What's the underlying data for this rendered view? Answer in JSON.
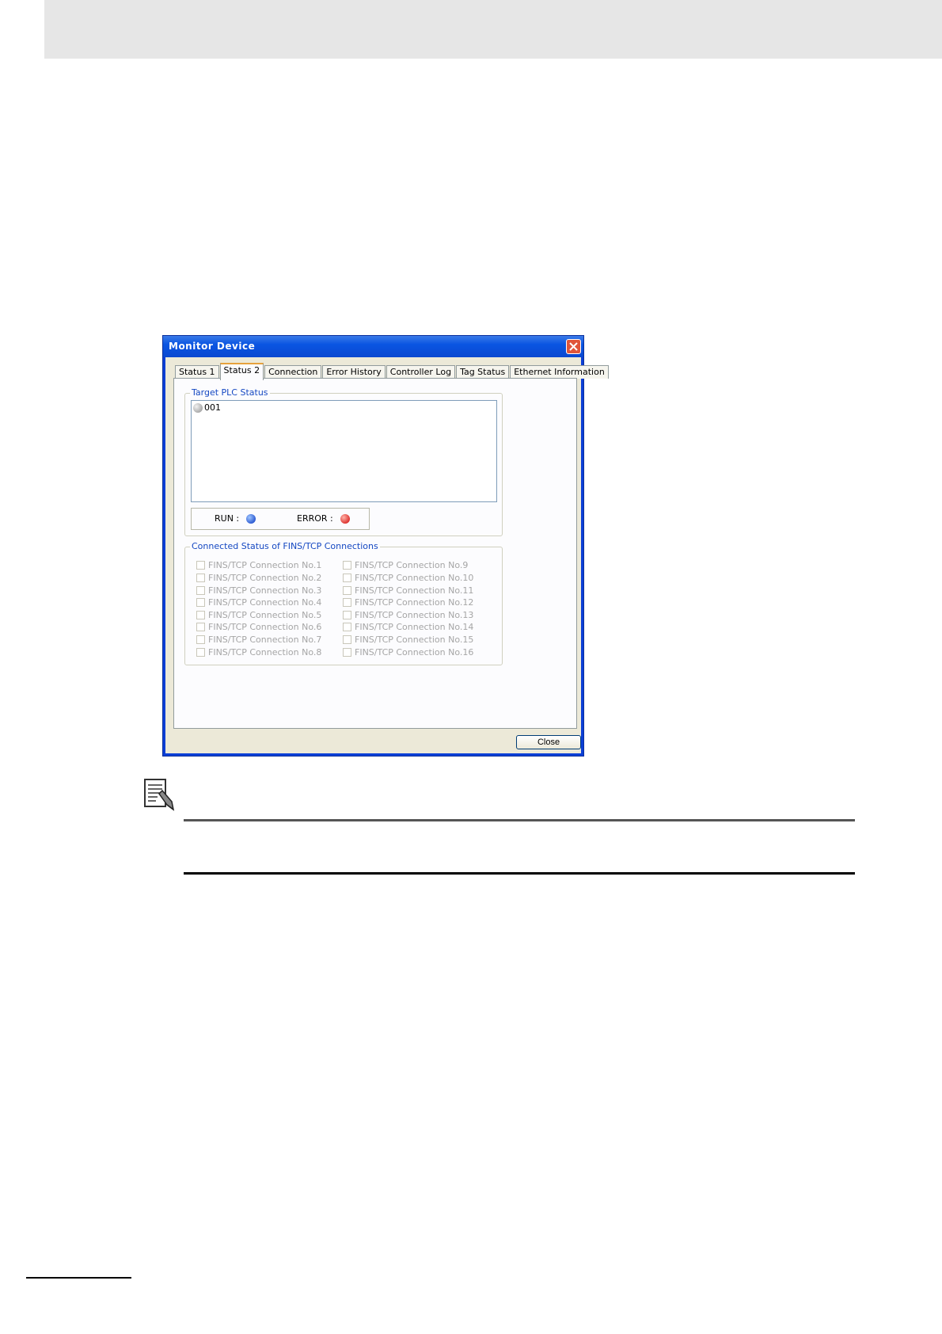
{
  "window": {
    "title": "Monitor Device"
  },
  "tabs": [
    "Status 1",
    "Status 2",
    "Connection",
    "Error History",
    "Controller Log",
    "Tag Status",
    "Ethernet Information"
  ],
  "target_plc": {
    "group_title": "Target PLC Status",
    "items": [
      {
        "label": "001",
        "icon": "grey-status-ball-icon"
      }
    ],
    "run_label": "RUN :",
    "error_label": "ERROR :",
    "run_color": "#0030c0",
    "error_color": "#d00000"
  },
  "connections": {
    "group_title": "Connected Status of FINS/TCP Connections",
    "left": [
      "FINS/TCP Connection No.1",
      "FINS/TCP Connection No.2",
      "FINS/TCP Connection No.3",
      "FINS/TCP Connection No.4",
      "FINS/TCP Connection No.5",
      "FINS/TCP Connection No.6",
      "FINS/TCP Connection No.7",
      "FINS/TCP Connection No.8"
    ],
    "right": [
      "FINS/TCP Connection No.9",
      "FINS/TCP Connection No.10",
      "FINS/TCP Connection No.11",
      "FINS/TCP Connection No.12",
      "FINS/TCP Connection No.13",
      "FINS/TCP Connection No.14",
      "FINS/TCP Connection No.15",
      "FINS/TCP Connection No.16"
    ]
  },
  "buttons": {
    "close": "Close"
  },
  "note": {
    "icon": "note-document-icon"
  }
}
